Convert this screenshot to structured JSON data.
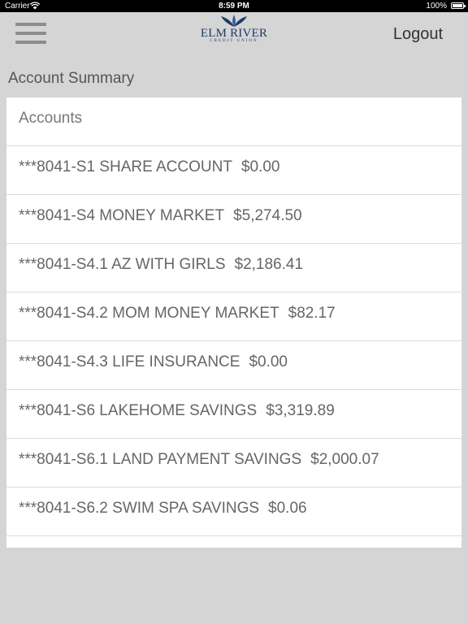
{
  "status_bar": {
    "carrier": "Carrier",
    "time": "8:59 PM",
    "battery": "100%"
  },
  "header": {
    "logo_name": "ELM RIVER",
    "logo_sub": "CREDIT UNION",
    "logout_label": "Logout"
  },
  "page": {
    "title": "Account Summary"
  },
  "accounts": {
    "header": "Accounts",
    "items": [
      {
        "name": "***8041-S1 SHARE ACCOUNT",
        "balance": "$0.00"
      },
      {
        "name": "***8041-S4 MONEY MARKET",
        "balance": "$5,274.50"
      },
      {
        "name": "***8041-S4.1 AZ WITH GIRLS",
        "balance": "$2,186.41"
      },
      {
        "name": "***8041-S4.2 MOM MONEY MARKET",
        "balance": "$82.17"
      },
      {
        "name": "***8041-S4.3 LIFE INSURANCE",
        "balance": "$0.00"
      },
      {
        "name": "***8041-S6 LAKEHOME SAVINGS",
        "balance": "$3,319.89"
      },
      {
        "name": "***8041-S6.1 LAND PAYMENT SAVINGS",
        "balance": "$2,000.07"
      },
      {
        "name": "***8041-S6.2 SWIM SPA SAVINGS",
        "balance": "$0.06"
      }
    ]
  },
  "icons": {
    "menu": "hamburger-menu-icon",
    "wifi": "wifi-icon",
    "battery": "battery-icon",
    "logo": "leaf-logo-icon"
  },
  "colors": {
    "background": "#d5d5d5",
    "panel": "#ffffff",
    "logo_blue": "#1f3b66",
    "menu_gray": "#8c8c8c"
  }
}
